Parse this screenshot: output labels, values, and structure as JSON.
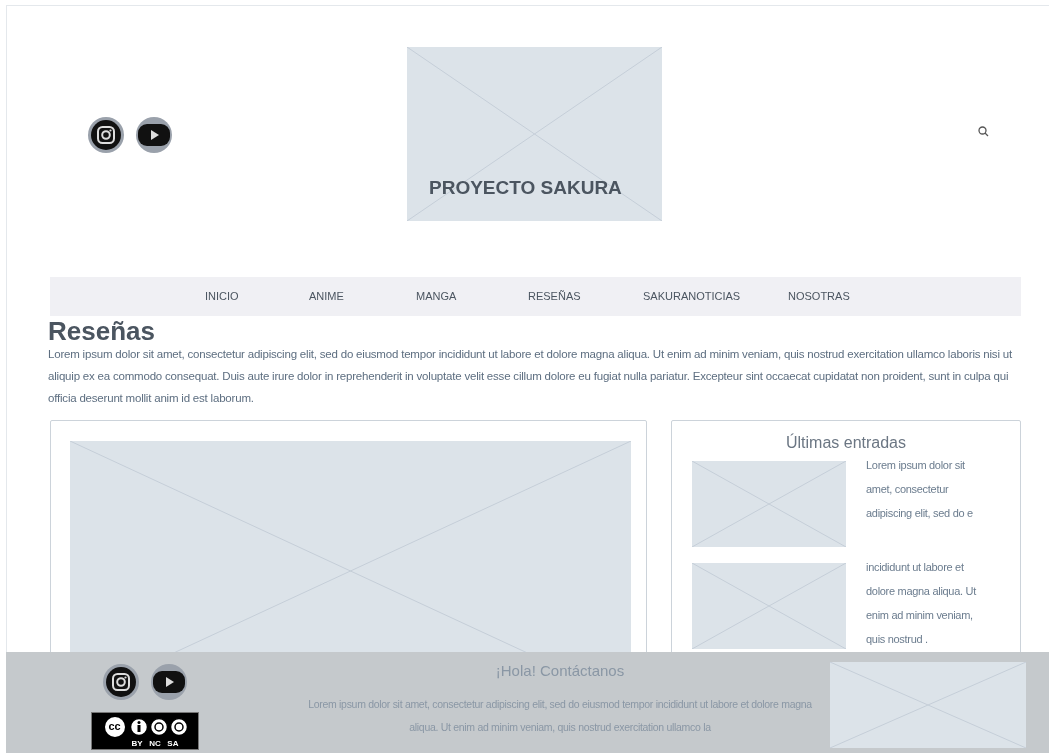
{
  "header": {
    "social": [
      {
        "kind": "instagram"
      },
      {
        "kind": "youtube"
      }
    ],
    "logo_text": "PROYECTO SAKURA"
  },
  "nav": {
    "items": [
      {
        "label": "INICIO"
      },
      {
        "label": "ANIME"
      },
      {
        "label": "MANGA"
      },
      {
        "label": "RESEÑAS"
      },
      {
        "label": "SAKURANOTICIAS"
      },
      {
        "label": "NOSOTRAS"
      }
    ]
  },
  "page": {
    "title": "Reseñas",
    "intro": "Lorem ipsum dolor sit amet, consectetur adipiscing elit, sed do eiusmod tempor incididunt ut labore et dolore magna aliqua. Ut enim ad minim veniam, quis nostrud exercitation ullamco laboris nisi ut aliquip ex ea commodo consequat. Duis aute irure dolor in reprehenderit in voluptate velit esse cillum dolore eu fugiat nulla pariatur. Excepteur sint occaecat cupidatat non proident, sunt in culpa qui officia deserunt mollit anim id est laborum."
  },
  "sidebar": {
    "title": "Últimas entradas",
    "entries": [
      {
        "text": "Lorem ipsum dolor sit amet, consectetur adipiscing elit, sed do e"
      },
      {
        "text": "incididunt ut labore et dolore magna aliqua. Ut enim ad minim veniam, quis nostrud ."
      }
    ]
  },
  "footer": {
    "social": [
      {
        "kind": "instagram"
      },
      {
        "kind": "youtube"
      }
    ],
    "license": {
      "symbol": "cc",
      "terms": [
        "BY",
        "NC",
        "SA"
      ]
    },
    "title": "¡Hola! Contáctanos",
    "text": "Lorem ipsum dolor sit amet, consectetur adipiscing elit, sed do eiusmod tempor incididunt ut labore et dolore magna aliqua. Ut enim ad minim veniam, quis nostrud exercitation ullamco la"
  }
}
